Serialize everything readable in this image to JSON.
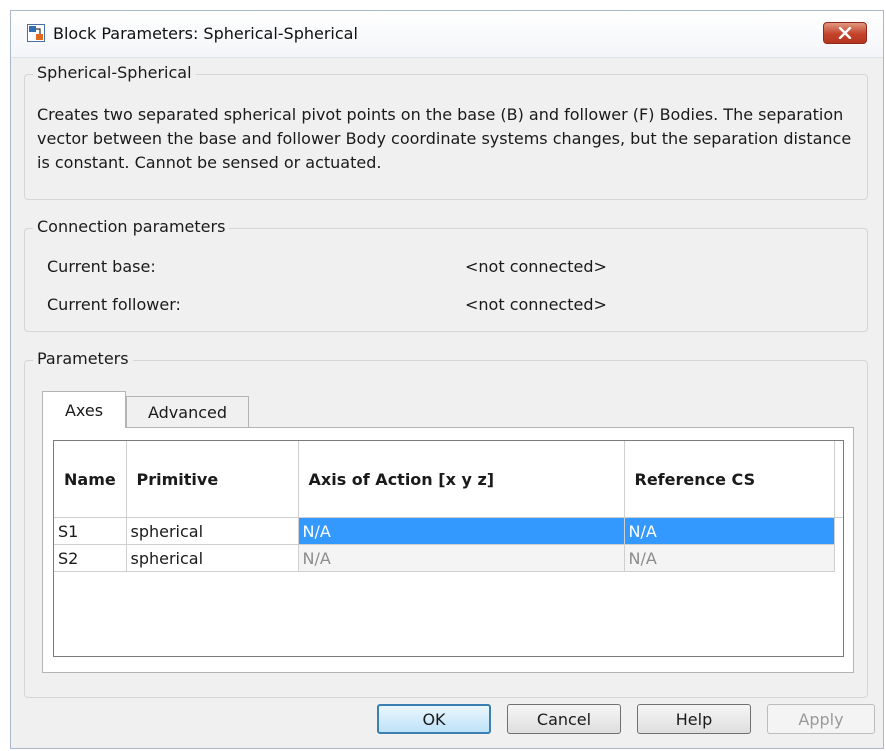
{
  "window": {
    "title": "Block Parameters: Spherical-Spherical"
  },
  "block": {
    "group_title": "Spherical-Spherical",
    "description": "Creates two separated spherical pivot points on the base (B) and follower (F) Bodies. The separation vector between the base and follower Body coordinate systems changes, but the separation distance is constant. Cannot be sensed or actuated."
  },
  "connection": {
    "group_title": "Connection parameters",
    "base_label": "Current base:",
    "base_value": "<not connected>",
    "follower_label": "Current follower:",
    "follower_value": "<not connected>"
  },
  "parameters": {
    "group_title": "Parameters",
    "tabs": [
      {
        "label": "Axes",
        "active": true
      },
      {
        "label": "Advanced",
        "active": false
      }
    ],
    "table": {
      "columns": [
        "Name",
        "Primitive",
        "Axis of Action [x y z]",
        "Reference CS"
      ],
      "rows": [
        {
          "name": "S1",
          "primitive": "spherical",
          "axis": "N/A",
          "ref": "N/A",
          "selected": true
        },
        {
          "name": "S2",
          "primitive": "spherical",
          "axis": "N/A",
          "ref": "N/A",
          "selected": false
        }
      ]
    }
  },
  "buttons": {
    "ok": "OK",
    "cancel": "Cancel",
    "help": "Help",
    "apply": "Apply"
  },
  "colors": {
    "selection": "#3399ff",
    "close_button": "#c4432b"
  }
}
